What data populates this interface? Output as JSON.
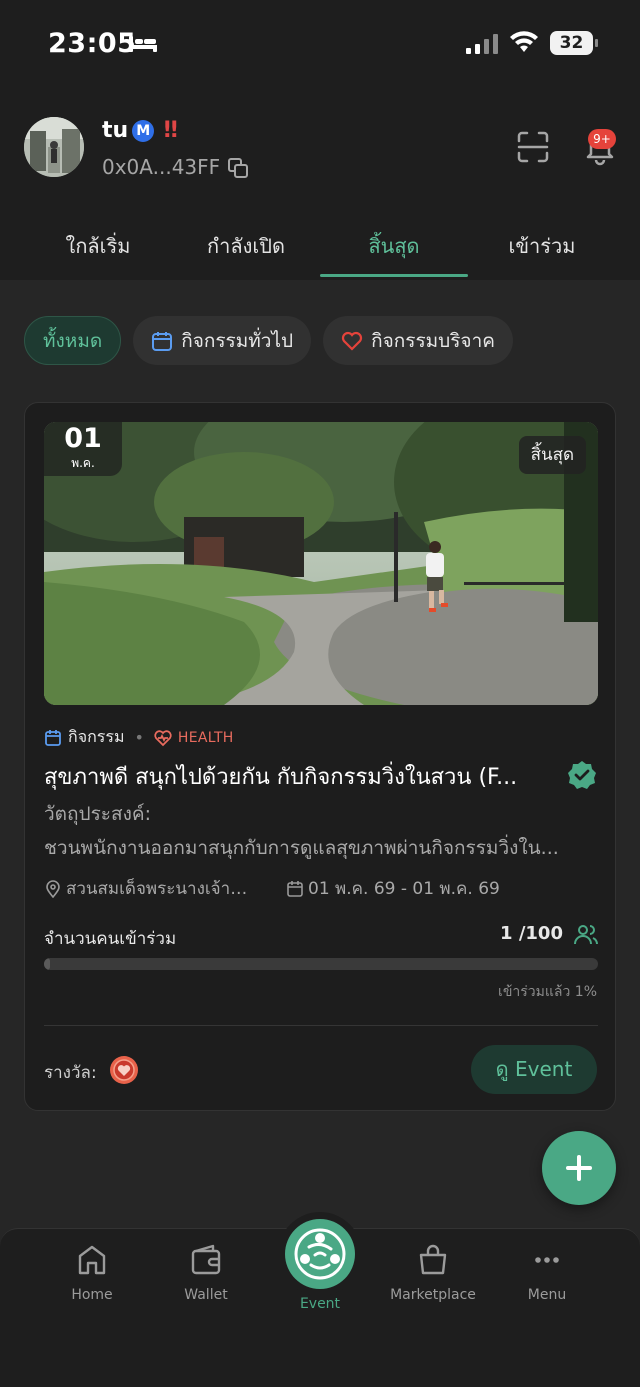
{
  "status_bar": {
    "time": "23:05",
    "battery": "32"
  },
  "profile": {
    "name": "tu",
    "verified_badge": "M",
    "alert": "!!",
    "address": "0x0A...43FF",
    "notification_count": "9+"
  },
  "tabs": [
    {
      "label": "ใกล้เริ่ม",
      "active": false
    },
    {
      "label": "กำลังเปิด",
      "active": false
    },
    {
      "label": "สิ้นสุด",
      "active": true
    },
    {
      "label": "เข้าร่วม",
      "active": false
    }
  ],
  "filters": [
    {
      "label": "ทั้งหมด",
      "active": true
    },
    {
      "label": "กิจกรรมทั่วไป",
      "icon": "calendar-icon",
      "active": false
    },
    {
      "label": "กิจกรรมบริจาค",
      "icon": "heart-icon",
      "active": false
    }
  ],
  "event_card": {
    "date_day": "01",
    "date_month": "พ.ค.",
    "status_badge": "สิ้นสุด",
    "category": "กิจกรรม",
    "tag": "HEALTH",
    "title": "สุขภาพดี สนุกไปด้วยกัน กับกิจกรรมวิ่งในสวน (F...",
    "objective_label": "วัตถุประสงค์:",
    "objective_text": "ชวนพนักงานออกมาสนุกกับการดูแลสุขภาพผ่านกิจกรรมวิ่งใน...",
    "location": "สวนสมเด็จพระนางเจ้าสิ...",
    "date_range": "01 พ.ค. 69 - 01 พ.ค. 69",
    "participants_label": "จำนวนคนเข้าร่วม",
    "participants_count": "1 /100",
    "progress_fraction": 0.01,
    "joined_text": "เข้าร่วมแล้ว 1%",
    "reward_label": "รางวัล:",
    "view_button": "ดู Event"
  },
  "bottom_nav": {
    "home": "Home",
    "wallet": "Wallet",
    "event": "Event",
    "marketplace": "Marketplace",
    "menu": "Menu"
  },
  "colors": {
    "accent": "#4aa885",
    "accent_text": "#5fc09a",
    "danger": "#e5433b",
    "background": "#262626"
  }
}
